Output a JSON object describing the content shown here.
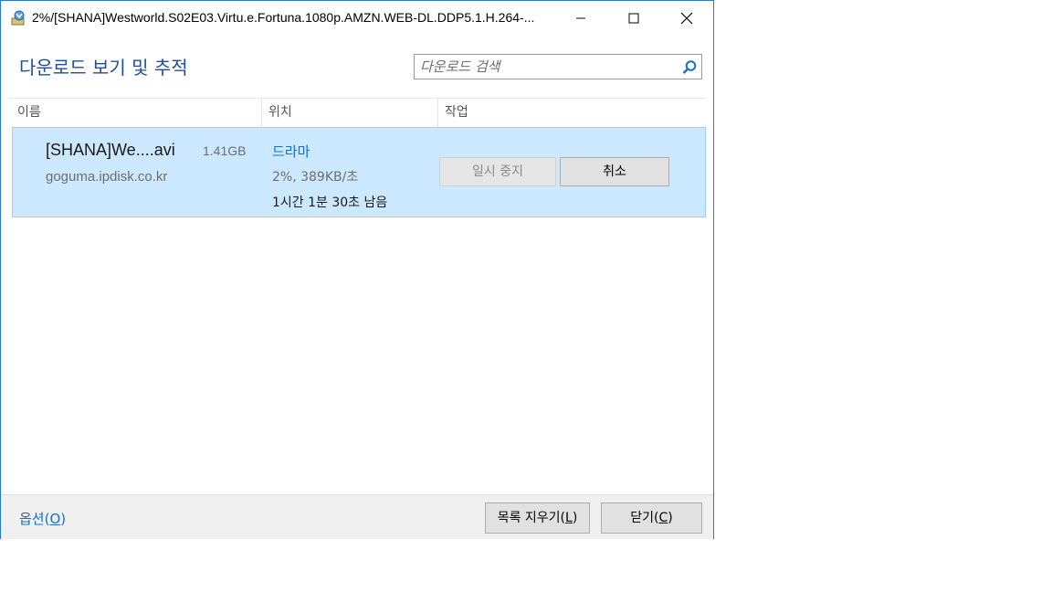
{
  "window": {
    "title": "2%/[SHANA]Westworld.S02E03.Virtu.e.Fortuna.1080p.AMZN.WEB-DL.DDP5.1.H.264-...",
    "icon": "download-app-icon",
    "controls": {
      "minimize": "minimize-icon",
      "maximize": "maximize-icon",
      "close": "close-icon"
    }
  },
  "header": {
    "title": "다운로드 보기 및 추적",
    "search_placeholder": "다운로드 검색",
    "search_value": "",
    "search_icon": "search-icon"
  },
  "columns": [
    "이름",
    "위치",
    "작업"
  ],
  "downloads": [
    {
      "name": "[SHANA]We....avi",
      "size": "1.41GB",
      "source": "goguma.ipdisk.co.kr",
      "location": "드라마",
      "progress": "2%, 389KB/초",
      "progress_percent": 2,
      "remaining": "1시간 1분 30초 남음",
      "pause_label": "일시 중지",
      "cancel_label": "취소"
    }
  ],
  "footer": {
    "options": {
      "label": "옵션(",
      "mnemonic": "O",
      "suffix": ")"
    },
    "clear": {
      "label": "목록 지우기(",
      "mnemonic": "L",
      "suffix": ")"
    },
    "close": {
      "label": "닫기(",
      "mnemonic": "C",
      "suffix": ")"
    }
  },
  "colors": {
    "accent": "#1f4e9c",
    "link": "#1a6fc4",
    "row_selected": "#cce8ff",
    "window_border": "#2b79c9"
  }
}
